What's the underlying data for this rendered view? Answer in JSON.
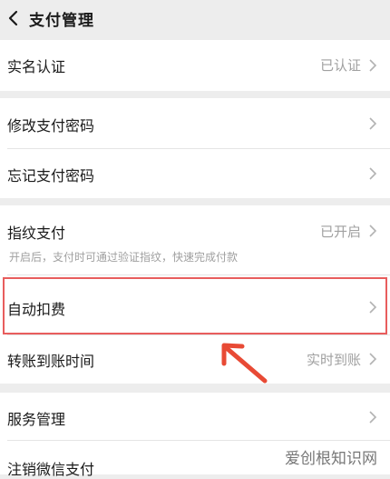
{
  "header": {
    "title": "支付管理"
  },
  "rows": {
    "realname": {
      "label": "实名认证",
      "value": "已认证"
    },
    "change_pwd": {
      "label": "修改支付密码"
    },
    "forgot_pwd": {
      "label": "忘记支付密码"
    },
    "fingerprint": {
      "label": "指纹支付",
      "value": "已开启",
      "description": "开启后，支付时可通过验证指纹，快速完成付款"
    },
    "auto_deduct": {
      "label": "自动扣费"
    },
    "transfer_time": {
      "label": "转账到账时间",
      "value": "实时到账"
    },
    "service_mgmt": {
      "label": "服务管理"
    },
    "cancel_wechat_pay": {
      "label": "注销微信支付"
    }
  },
  "watermark": "爱创根知识网",
  "colors": {
    "highlight": "#e85d5d",
    "arrow": "#e84a35",
    "background": "#ededed"
  }
}
